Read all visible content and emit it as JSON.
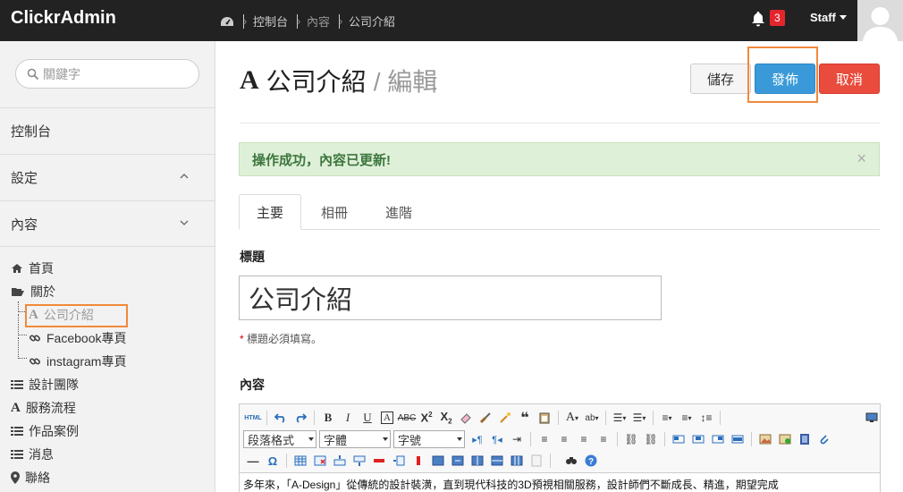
{
  "app": {
    "brand": "ClickrAdmin"
  },
  "breadcrumb": [
    "控制台",
    "內容",
    "公司介紹"
  ],
  "notifications": {
    "count": "3"
  },
  "user": {
    "name": "Staff"
  },
  "sidebar": {
    "search_placeholder": "關鍵字",
    "sections": [
      {
        "label": "控制台"
      },
      {
        "label": "設定"
      },
      {
        "label": "內容"
      }
    ],
    "tree": [
      {
        "label": "首頁",
        "icon": "home-icon"
      },
      {
        "label": "關於",
        "icon": "folder-open-icon"
      },
      {
        "label": "公司介紹",
        "icon": "font-icon"
      },
      {
        "label": "Facebook專頁",
        "icon": "link-icon"
      },
      {
        "label": "instagram專頁",
        "icon": "link-icon"
      },
      {
        "label": "設計團隊",
        "icon": "list-icon"
      },
      {
        "label": "服務流程",
        "icon": "font-icon"
      },
      {
        "label": "作品案例",
        "icon": "list-icon"
      },
      {
        "label": "消息",
        "icon": "list-icon"
      },
      {
        "label": "聯絡",
        "icon": "map-marker-icon"
      }
    ]
  },
  "page": {
    "title": "公司介紹",
    "mode": "/ 編輯",
    "buttons": {
      "save": "儲存",
      "publish": "發佈",
      "cancel": "取消"
    },
    "alert": "操作成功，內容已更新!",
    "alert_close": "×",
    "tabs": [
      "主要",
      "相冊",
      "進階"
    ],
    "title_label": "標題",
    "title_value": "公司介紹",
    "required_mark": "*",
    "hint": " 標題必須填寫。",
    "content_label": "內容"
  },
  "editor": {
    "format_select": "段落格式",
    "font_select": "字體",
    "size_select": "字號",
    "body_text": "多年來，「A-Design」從傳統的設計裝潢，直到現代科技的3D預視相關服務，設計師們不斷成長、精進，期望完成"
  },
  "colors": {
    "accent": "#3a9ad9",
    "danger": "#e94b3c",
    "highlight": "#f08a3c"
  }
}
